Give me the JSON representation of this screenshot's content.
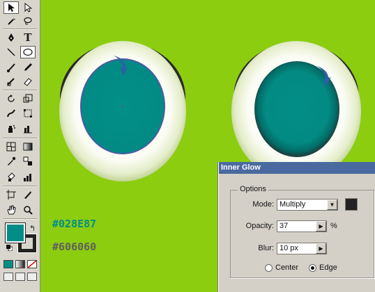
{
  "colors": {
    "canvas_bg": "#8ccd10",
    "fill_color": "#028E87",
    "stroke_color": "#222222",
    "glow_color": "#222222",
    "panel_title_bg": "#4a6a9f"
  },
  "toolbox": {
    "tools": [
      "selection-icon",
      "direct-selection-icon",
      "magic-wand-icon",
      "lasso-icon",
      "pen-icon",
      "type-icon",
      "line-icon",
      "ellipse-icon",
      "paintbrush-icon",
      "pencil-icon",
      "blob-brush-icon",
      "eraser-icon",
      "rotate-icon",
      "scale-icon",
      "warp-icon",
      "free-transform-icon",
      "symbol-sprayer-icon",
      "column-graph-icon",
      "mesh-icon",
      "gradient-icon",
      "eyedropper-icon",
      "blend-icon",
      "live-paint-icon",
      "bar-graph-icon",
      "artboard-icon",
      "slice-icon",
      "hand-icon",
      "zoom-icon"
    ],
    "type_tool_glyph": "T"
  },
  "canvas": {
    "fill_hex_label": "#028E87",
    "glow_hex_label": "#606060",
    "fill_hex_color": "#028E87",
    "glow_hex_color": "#606060"
  },
  "inner_glow_panel": {
    "title": "Inner Glow",
    "group_label": "Options",
    "mode_label": "Mode:",
    "mode_value": "Multiply",
    "opacity_label": "Opacity:",
    "opacity_value": "37",
    "opacity_unit": "%",
    "blur_label": "Blur:",
    "blur_value": "10 px",
    "center_label": "Center",
    "edge_label": "Edge",
    "selected_source": "Edge"
  }
}
